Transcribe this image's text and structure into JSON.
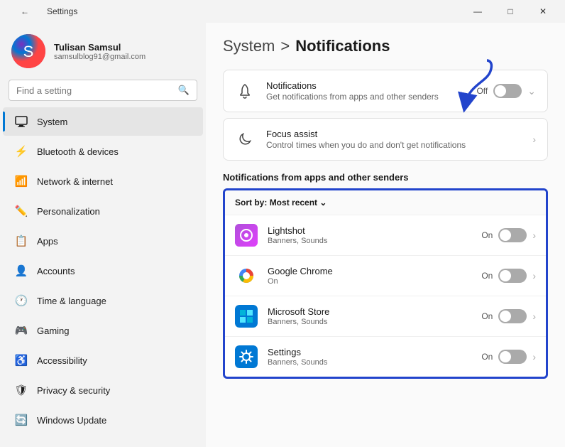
{
  "titlebar": {
    "title": "Settings",
    "back_icon": "←",
    "minimize": "—",
    "maximize": "□",
    "close": "✕"
  },
  "sidebar": {
    "profile": {
      "name": "Tulisan Samsul",
      "email": "samsulblog91@gmail.com",
      "avatar_icon": "🔵"
    },
    "search": {
      "placeholder": "Find a setting"
    },
    "nav_items": [
      {
        "id": "system",
        "label": "System",
        "icon": "🖥",
        "active": true
      },
      {
        "id": "bluetooth",
        "label": "Bluetooth & devices",
        "icon": "🔷",
        "active": false
      },
      {
        "id": "network",
        "label": "Network & internet",
        "icon": "🌐",
        "active": false
      },
      {
        "id": "personalization",
        "label": "Personalization",
        "icon": "✏️",
        "active": false
      },
      {
        "id": "apps",
        "label": "Apps",
        "icon": "📦",
        "active": false
      },
      {
        "id": "accounts",
        "label": "Accounts",
        "icon": "👤",
        "active": false
      },
      {
        "id": "time",
        "label": "Time & language",
        "icon": "🕐",
        "active": false
      },
      {
        "id": "gaming",
        "label": "Gaming",
        "icon": "🎮",
        "active": false
      },
      {
        "id": "accessibility",
        "label": "Accessibility",
        "icon": "♿",
        "active": false
      },
      {
        "id": "privacy",
        "label": "Privacy & security",
        "icon": "🛡",
        "active": false
      },
      {
        "id": "update",
        "label": "Windows Update",
        "icon": "🔄",
        "active": false
      }
    ]
  },
  "main": {
    "breadcrumb_parent": "System",
    "breadcrumb_separator": ">",
    "breadcrumb_current": "Notifications",
    "notifications_row": {
      "icon": "🔔",
      "title": "Notifications",
      "subtitle": "Get notifications from apps and other senders",
      "toggle_label": "Off",
      "toggle_on": false
    },
    "focus_assist_row": {
      "icon": "🌙",
      "title": "Focus assist",
      "subtitle": "Control times when you do and don't get notifications"
    },
    "apps_section_title": "Notifications from apps and other senders",
    "sort_label": "Sort by:",
    "sort_value": "Most recent",
    "sort_icon": "⌄",
    "app_rows": [
      {
        "id": "lightshot",
        "name": "Lightshot",
        "detail": "Banners, Sounds",
        "toggle_on": false,
        "toggle_label": "On",
        "icon_color": "#9b4dca",
        "icon": "📷"
      },
      {
        "id": "chrome",
        "name": "Google Chrome",
        "detail": "On",
        "toggle_on": false,
        "toggle_label": "On",
        "icon_color": "#ff4444",
        "icon": "🌐"
      },
      {
        "id": "msstore",
        "name": "Microsoft Store",
        "detail": "Banners, Sounds",
        "toggle_on": false,
        "toggle_label": "On",
        "icon_color": "#0078d4",
        "icon": "🛍"
      },
      {
        "id": "settings",
        "name": "Settings",
        "detail": "Banners, Sounds",
        "toggle_on": false,
        "toggle_label": "On",
        "icon_color": "#0078d4",
        "icon": "⚙"
      }
    ]
  }
}
